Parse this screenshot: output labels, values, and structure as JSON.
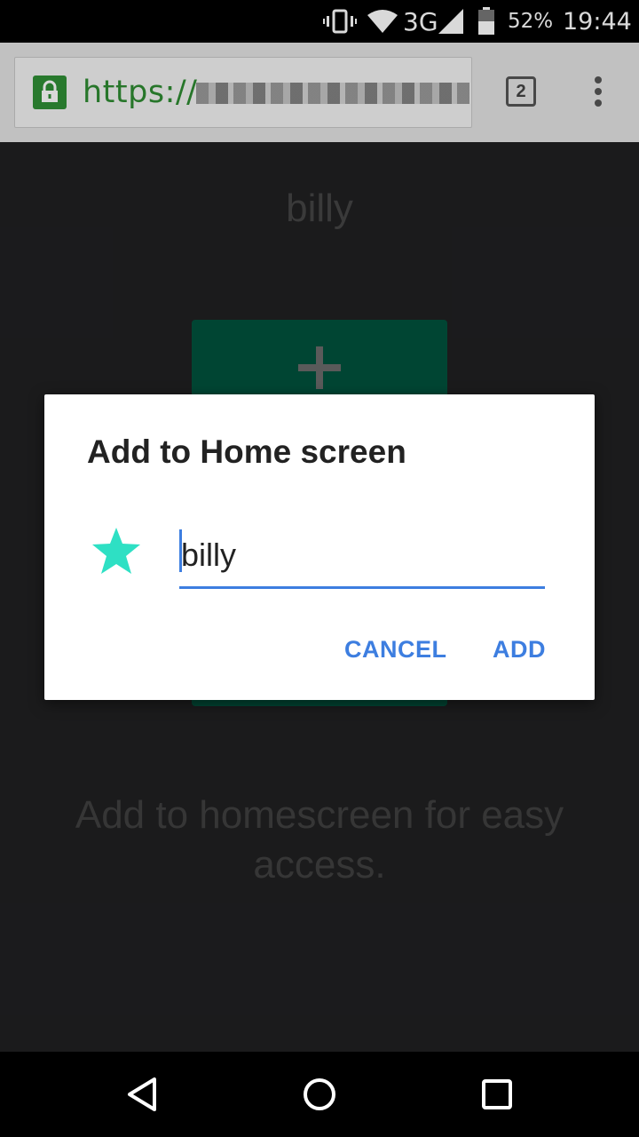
{
  "status_bar": {
    "battery": "52%",
    "time": "19:44",
    "network": "3G"
  },
  "browser": {
    "url_prefix": "https://",
    "tab_count": "2"
  },
  "page": {
    "title": "billy",
    "hint": "Add to homescreen for easy access."
  },
  "dialog": {
    "title": "Add to Home screen",
    "name_value": "billy",
    "cancel_label": "CANCEL",
    "add_label": "ADD",
    "accent_color": "#3d7ee0",
    "icon": "star-icon",
    "icon_color": "#2ee0c4"
  }
}
